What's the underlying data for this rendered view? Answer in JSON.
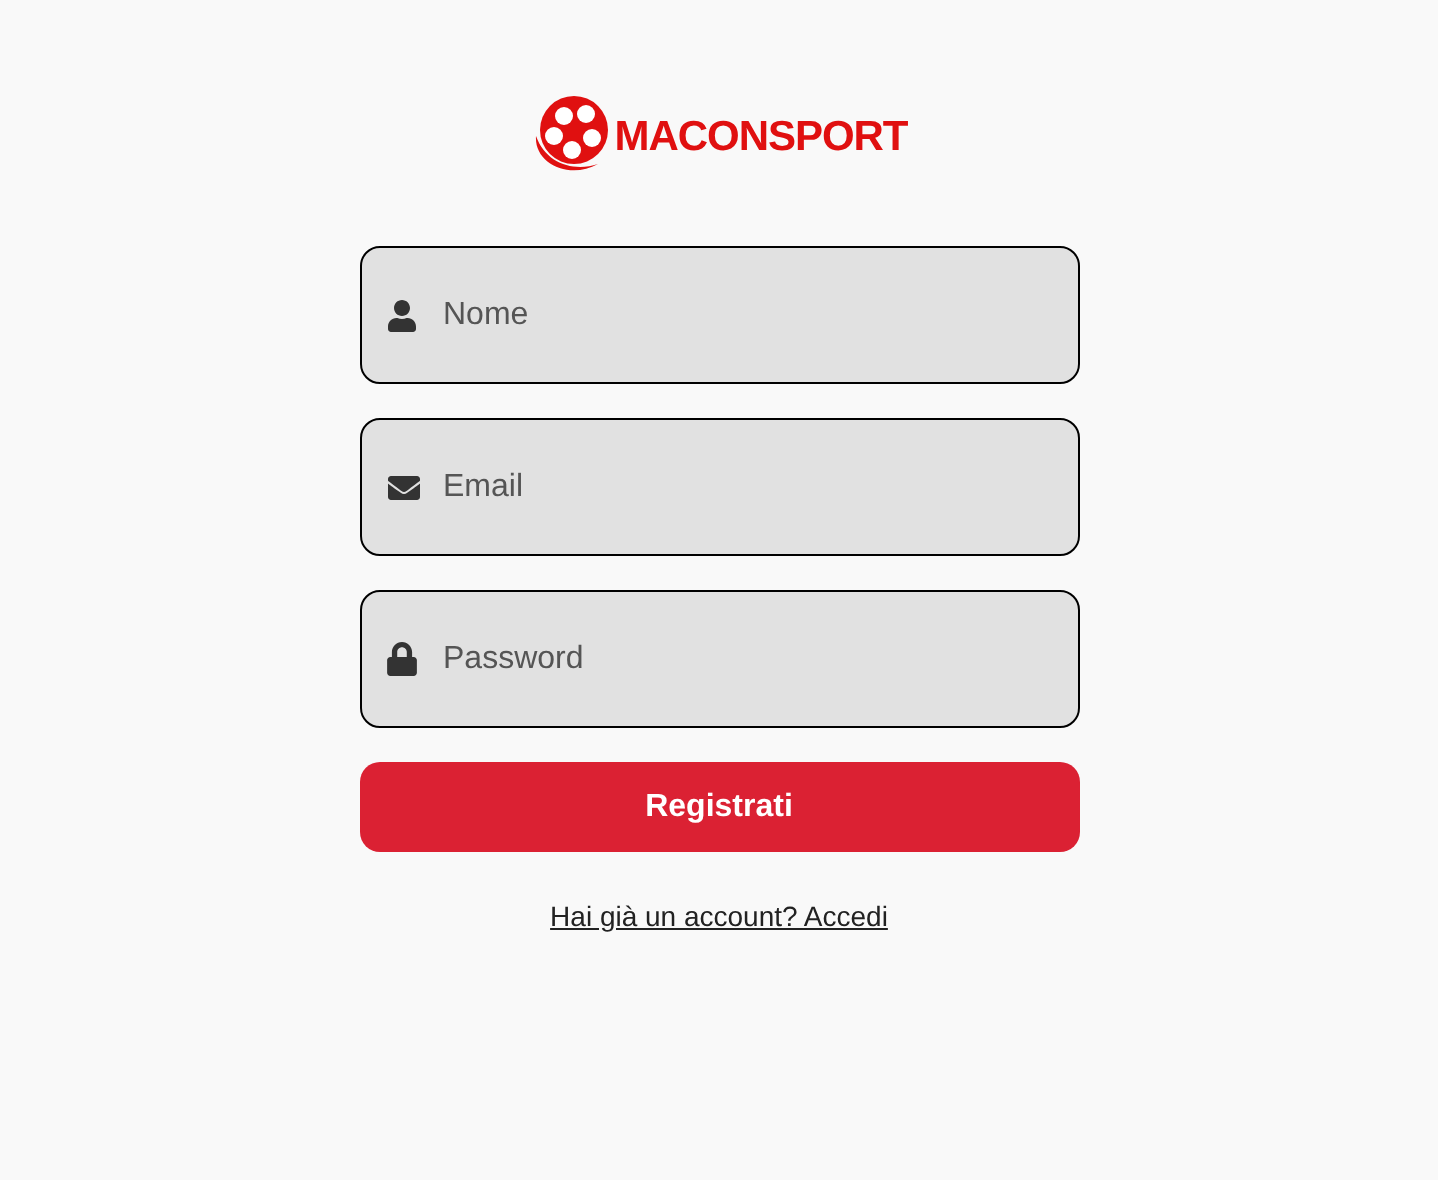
{
  "logo": {
    "text": "MACONSPORT"
  },
  "fields": [
    {
      "kind": "person",
      "placeholder": "Nome"
    },
    {
      "kind": "email",
      "placeholder": "Email"
    },
    {
      "kind": "password",
      "placeholder": "Password"
    }
  ],
  "submit": {
    "label": "Registrati"
  },
  "login_link": {
    "label": "Hai già un account? Accedi"
  }
}
